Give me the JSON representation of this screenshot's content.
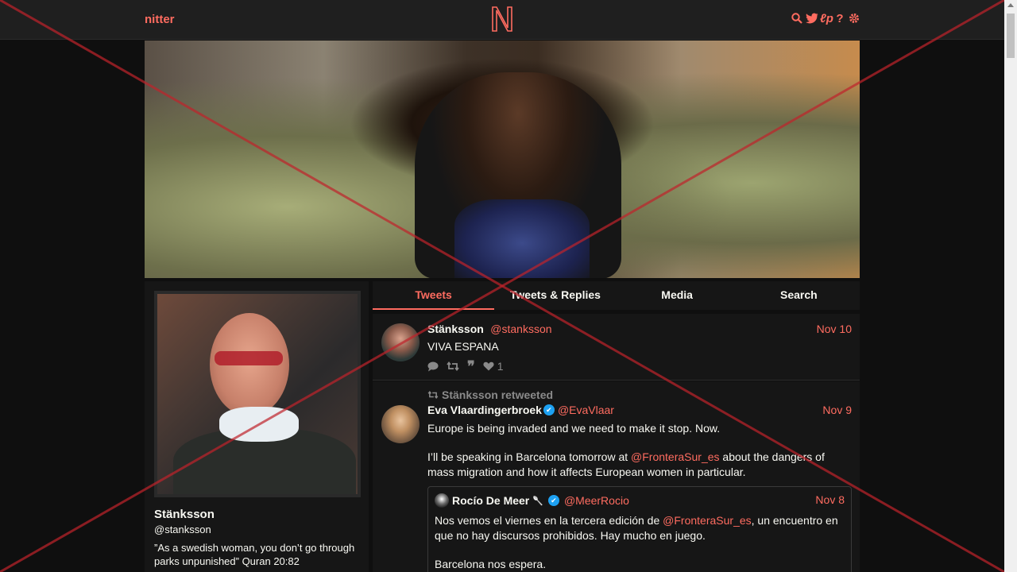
{
  "nav": {
    "brand": "nitter",
    "logo_letter": "N",
    "icons": [
      "search-icon",
      "twitter-icon",
      "rss-icon",
      "help-icon",
      "settings-icon"
    ]
  },
  "colors": {
    "accent": "#ff6c60",
    "background": "#0f0f0f",
    "panel": "#161616",
    "verified": "#1da1f2"
  },
  "profile": {
    "name": "Stänksson",
    "handle": "@stanksson",
    "bio": "”As a swedish woman, you don’t go through parks unpunished” Quran 20:82"
  },
  "tabs": [
    "Tweets",
    "Tweets & Replies",
    "Media",
    "Search"
  ],
  "active_tab": "Tweets",
  "tweets": [
    {
      "fullname": "Stänksson",
      "username": "@stanksson",
      "date": "Nov 10",
      "text": "VIVA ESPANA",
      "stats": {
        "replies": "",
        "retweets": "",
        "quotes": "",
        "likes": "1"
      }
    },
    {
      "retweet_header": "Stänksson retweeted",
      "fullname": "Eva Vlaardingerbroek",
      "username": "@EvaVlaar",
      "date": "Nov 9",
      "text_p1": "Europe is being invaded and we need to make it stop. Now.",
      "text_p2_a": "I’ll be speaking in Barcelona tomorrow at ",
      "text_p2_mention": "@FronteraSur_es",
      "text_p2_b": " about the dangers of mass migration and how it affects European women in particular.",
      "quote": {
        "fullname": "Rocío De Meer",
        "emoji": "🥄",
        "username": "@MeerRocio",
        "date": "Nov 8",
        "text_a": "Nos vemos el viernes en la tercera edición de ",
        "mention": "@FronteraSur_es",
        "text_b": ", un encuentro en que no hay discursos prohibidos. Hay mucho en juego.",
        "text_p2": "Barcelona nos espera."
      }
    }
  ]
}
